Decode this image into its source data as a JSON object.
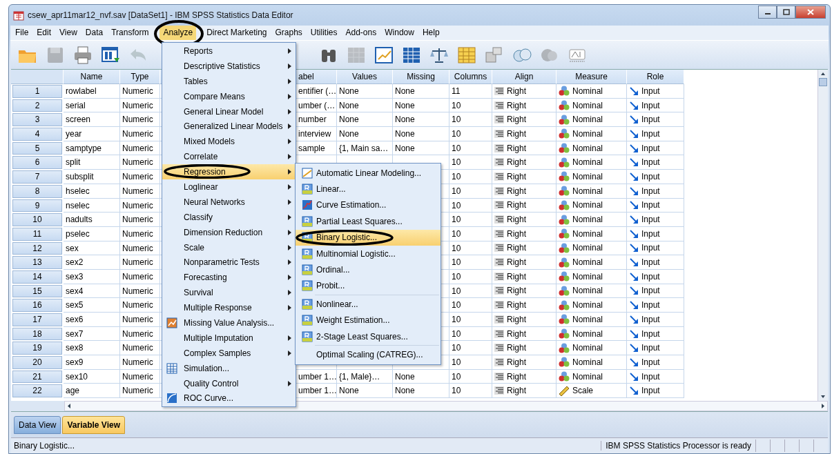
{
  "window": {
    "title": "csew_apr11mar12_nvf.sav [DataSet1] - IBM SPSS Statistics Data Editor"
  },
  "menu_bar": [
    {
      "label": "File",
      "selected": false,
      "circled": false
    },
    {
      "label": "Edit",
      "selected": false,
      "circled": false
    },
    {
      "label": "View",
      "selected": false,
      "circled": false
    },
    {
      "label": "Data",
      "selected": false,
      "circled": false
    },
    {
      "label": "Transform",
      "selected": false,
      "circled": false
    },
    {
      "label": "Analyze",
      "selected": true,
      "circled": true
    },
    {
      "label": "Direct Marketing",
      "selected": false,
      "circled": false
    },
    {
      "label": "Graphs",
      "selected": false,
      "circled": false
    },
    {
      "label": "Utilities",
      "selected": false,
      "circled": false
    },
    {
      "label": "Add-ons",
      "selected": false,
      "circled": false
    },
    {
      "label": "Window",
      "selected": false,
      "circled": false
    },
    {
      "label": "Help",
      "selected": false,
      "circled": false
    }
  ],
  "toolbar": [
    {
      "kind": "open",
      "disabled": false
    },
    {
      "kind": "save",
      "disabled": true
    },
    {
      "kind": "print",
      "disabled": false
    },
    {
      "kind": "import",
      "disabled": false
    },
    {
      "kind": "undo",
      "disabled": true
    },
    {
      "kind": "gap"
    },
    {
      "kind": "find",
      "disabled": false
    },
    {
      "kind": "grid",
      "disabled": true
    },
    {
      "kind": "chart",
      "disabled": false
    },
    {
      "kind": "table",
      "disabled": false
    },
    {
      "kind": "scales",
      "disabled": false
    },
    {
      "kind": "spreadsheet",
      "disabled": false
    },
    {
      "kind": "value-labels",
      "disabled": false
    },
    {
      "kind": "circles",
      "disabled": false
    },
    {
      "kind": "circle",
      "disabled": true
    },
    {
      "kind": "label",
      "disabled": false
    }
  ],
  "table": {
    "columns": [
      "Name",
      "Type",
      "",
      "abel",
      "Values",
      "Missing",
      "Columns",
      "Align",
      "Measure",
      "Role"
    ],
    "rows": [
      {
        "number": "1",
        "name": "rowlabel",
        "type": "Numeric",
        "label": "entifier (…",
        "values": "None",
        "missing": "None",
        "columns": "11",
        "align": "Right",
        "measure": "Nominal",
        "kind": "nominal",
        "role": "Input"
      },
      {
        "number": "2",
        "name": "serial",
        "type": "Numeric",
        "label": "umber (…",
        "values": "None",
        "missing": "None",
        "columns": "10",
        "align": "Right",
        "measure": "Nominal",
        "kind": "nominal",
        "role": "Input"
      },
      {
        "number": "3",
        "name": "screen",
        "type": "Numeric",
        "label": "number",
        "values": "None",
        "missing": "None",
        "columns": "10",
        "align": "Right",
        "measure": "Nominal",
        "kind": "nominal",
        "role": "Input"
      },
      {
        "number": "4",
        "name": "year",
        "type": "Numeric",
        "label": "interview",
        "values": "None",
        "missing": "None",
        "columns": "10",
        "align": "Right",
        "measure": "Nominal",
        "kind": "nominal",
        "role": "Input"
      },
      {
        "number": "5",
        "name": "samptype",
        "type": "Numeric",
        "label": "sample",
        "values": "{1, Main sa…",
        "missing": "None",
        "columns": "10",
        "align": "Right",
        "measure": "Nominal",
        "kind": "nominal",
        "role": "Input"
      },
      {
        "number": "6",
        "name": "split",
        "type": "Numeric",
        "columns": "10",
        "align": "Right",
        "measure": "Nominal",
        "kind": "nominal",
        "role": "Input"
      },
      {
        "number": "7",
        "name": "subsplit",
        "type": "Numeric",
        "columns": "10",
        "align": "Right",
        "measure": "Nominal",
        "kind": "nominal",
        "role": "Input"
      },
      {
        "number": "8",
        "name": "hselec",
        "type": "Numeric",
        "columns": "10",
        "align": "Right",
        "measure": "Nominal",
        "kind": "nominal",
        "role": "Input"
      },
      {
        "number": "9",
        "name": "nselec",
        "type": "Numeric",
        "columns": "10",
        "align": "Right",
        "measure": "Nominal",
        "kind": "nominal",
        "role": "Input"
      },
      {
        "number": "10",
        "name": "nadults",
        "type": "Numeric",
        "columns": "10",
        "align": "Right",
        "measure": "Nominal",
        "kind": "nominal",
        "role": "Input"
      },
      {
        "number": "11",
        "name": "pselec",
        "type": "Numeric",
        "columns": "10",
        "align": "Right",
        "measure": "Nominal",
        "kind": "nominal",
        "role": "Input"
      },
      {
        "number": "12",
        "name": "sex",
        "type": "Numeric",
        "columns": "10",
        "align": "Right",
        "measure": "Nominal",
        "kind": "nominal",
        "role": "Input"
      },
      {
        "number": "13",
        "name": "sex2",
        "type": "Numeric",
        "columns": "10",
        "align": "Right",
        "measure": "Nominal",
        "kind": "nominal",
        "role": "Input"
      },
      {
        "number": "14",
        "name": "sex3",
        "type": "Numeric",
        "columns": "10",
        "align": "Right",
        "measure": "Nominal",
        "kind": "nominal",
        "role": "Input"
      },
      {
        "number": "15",
        "name": "sex4",
        "type": "Numeric",
        "columns": "10",
        "align": "Right",
        "measure": "Nominal",
        "kind": "nominal",
        "role": "Input"
      },
      {
        "number": "16",
        "name": "sex5",
        "type": "Numeric",
        "columns": "10",
        "align": "Right",
        "measure": "Nominal",
        "kind": "nominal",
        "role": "Input"
      },
      {
        "number": "17",
        "name": "sex6",
        "type": "Numeric",
        "columns": "10",
        "align": "Right",
        "measure": "Nominal",
        "kind": "nominal",
        "role": "Input"
      },
      {
        "number": "18",
        "name": "sex7",
        "type": "Numeric",
        "columns": "10",
        "align": "Right",
        "measure": "Nominal",
        "kind": "nominal",
        "role": "Input"
      },
      {
        "number": "19",
        "name": "sex8",
        "type": "Numeric",
        "columns": "10",
        "align": "Right",
        "measure": "Nominal",
        "kind": "nominal",
        "role": "Input"
      },
      {
        "number": "20",
        "name": "sex9",
        "type": "Numeric",
        "columns": "10",
        "align": "Right",
        "measure": "Nominal",
        "kind": "nominal",
        "role": "Input"
      },
      {
        "number": "21",
        "name": "sex10",
        "type": "Numeric",
        "label": "umber 1…",
        "values": "{1, Male}…",
        "missing": "None",
        "columns": "10",
        "align": "Right",
        "measure": "Nominal",
        "kind": "nominal",
        "role": "Input"
      },
      {
        "number": "22",
        "name": "age",
        "type": "Numeric",
        "label": "umber 1…",
        "values": "None",
        "missing": "None",
        "columns": "10",
        "align": "Right",
        "measure": "Scale",
        "kind": "scale",
        "role": "Input"
      }
    ]
  },
  "analyze_menu": [
    {
      "label": "Reports",
      "submenu": true,
      "selected": false,
      "circled": false
    },
    {
      "label": "Descriptive Statistics",
      "submenu": true,
      "selected": false,
      "circled": false
    },
    {
      "label": "Tables",
      "submenu": true,
      "selected": false,
      "circled": false
    },
    {
      "label": "Compare Means",
      "submenu": true,
      "selected": false,
      "circled": false
    },
    {
      "label": "General Linear Model",
      "submenu": true,
      "selected": false,
      "circled": false
    },
    {
      "label": "Generalized Linear Models",
      "submenu": true,
      "selected": false,
      "circled": false
    },
    {
      "label": "Mixed Models",
      "submenu": true,
      "selected": false,
      "circled": false
    },
    {
      "label": "Correlate",
      "submenu": true,
      "selected": false,
      "circled": false
    },
    {
      "label": "Regression",
      "submenu": true,
      "selected": true,
      "circled": true
    },
    {
      "label": "Loglinear",
      "submenu": true,
      "selected": false,
      "circled": false
    },
    {
      "label": "Neural Networks",
      "submenu": true,
      "selected": false,
      "circled": false
    },
    {
      "label": "Classify",
      "submenu": true,
      "selected": false,
      "circled": false
    },
    {
      "label": "Dimension Reduction",
      "submenu": true,
      "selected": false,
      "circled": false
    },
    {
      "label": "Scale",
      "submenu": true,
      "selected": false,
      "circled": false
    },
    {
      "label": "Nonparametric Tests",
      "submenu": true,
      "selected": false,
      "circled": false
    },
    {
      "label": "Forecasting",
      "submenu": true,
      "selected": false,
      "circled": false
    },
    {
      "label": "Survival",
      "submenu": true,
      "selected": false,
      "circled": false
    },
    {
      "label": "Multiple Response",
      "submenu": true,
      "selected": false,
      "circled": false
    },
    {
      "label": "Missing Value Analysis...",
      "submenu": false,
      "selected": false,
      "circled": false,
      "kind": "missing"
    },
    {
      "label": "Multiple Imputation",
      "submenu": true,
      "selected": false,
      "circled": false
    },
    {
      "label": "Complex Samples",
      "submenu": true,
      "selected": false,
      "circled": false
    },
    {
      "label": "Simulation...",
      "submenu": false,
      "selected": false,
      "circled": false,
      "kind": "simulation"
    },
    {
      "label": "Quality Control",
      "submenu": true,
      "selected": false,
      "circled": false
    },
    {
      "label": "ROC Curve...",
      "submenu": false,
      "selected": false,
      "circled": false,
      "kind": "roc"
    }
  ],
  "regression_submenu": [
    {
      "label": "Automatic Linear Modeling...",
      "kind": "auto",
      "selected": false,
      "circled": false
    },
    {
      "label": "Linear...",
      "kind": "r",
      "selected": false,
      "circled": false
    },
    {
      "label": "Curve Estimation...",
      "kind": "curve",
      "selected": false,
      "circled": false
    },
    {
      "label": "Partial Least Squares...",
      "kind": "r",
      "selected": false,
      "circled": false
    },
    {
      "label": "Binary Logistic...",
      "kind": "r",
      "selected": true,
      "circled": true
    },
    {
      "label": "Multinomial Logistic...",
      "kind": "r",
      "selected": false,
      "circled": false
    },
    {
      "label": "Ordinal...",
      "kind": "r",
      "selected": false,
      "circled": false
    },
    {
      "label": "Probit...",
      "kind": "r",
      "selected": false,
      "circled": false,
      "separator_after": true
    },
    {
      "label": "Nonlinear...",
      "kind": "r",
      "selected": false,
      "circled": false
    },
    {
      "label": "Weight Estimation...",
      "kind": "r",
      "selected": false,
      "circled": false
    },
    {
      "label": "2-Stage Least Squares...",
      "kind": "r",
      "selected": false,
      "circled": false,
      "separator_after": true
    },
    {
      "label": "Optimal Scaling (CATREG)...",
      "kind": "plain",
      "selected": false,
      "circled": false
    }
  ],
  "view_tabs": [
    {
      "label": "Data View",
      "selected": false
    },
    {
      "label": "Variable View",
      "selected": true
    }
  ],
  "status_bar": {
    "message": "Binary Logistic...",
    "processor": "IBM SPSS Statistics Processor is ready"
  }
}
